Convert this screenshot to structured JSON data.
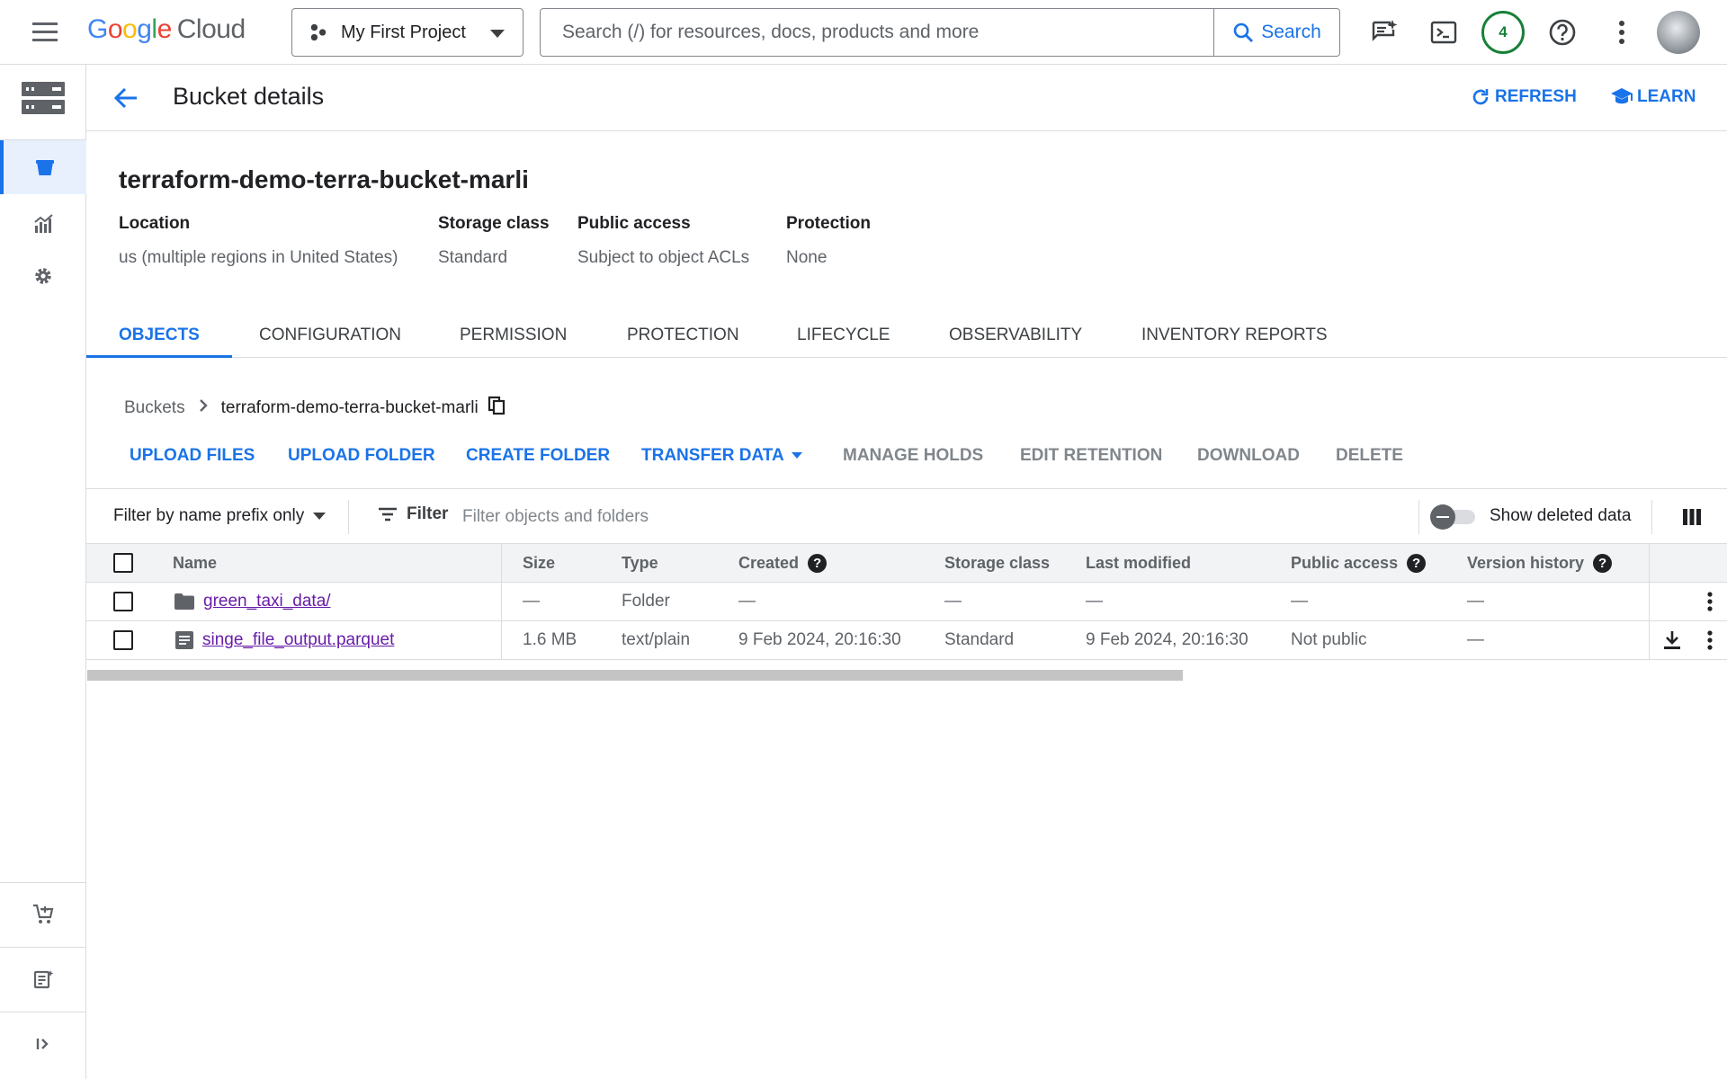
{
  "topbar": {
    "logo_google": [
      "G",
      "o",
      "o",
      "g",
      "l",
      "e"
    ],
    "logo_product": "Cloud",
    "project_name": "My First Project",
    "search_placeholder": "Search (/) for resources, docs, products and more",
    "search_button": "Search",
    "notification_count": "4"
  },
  "header": {
    "title": "Bucket details",
    "refresh_label": "REFRESH",
    "learn_label": "LEARN"
  },
  "bucket": {
    "name": "terraform-demo-terra-bucket-marli",
    "info": [
      {
        "label": "Location",
        "value": "us (multiple regions in United States)"
      },
      {
        "label": "Storage class",
        "value": "Standard"
      },
      {
        "label": "Public access",
        "value": "Subject to object ACLs"
      },
      {
        "label": "Protection",
        "value": "None"
      }
    ]
  },
  "tabs": [
    "OBJECTS",
    "CONFIGURATION",
    "PERMISSION",
    "PROTECTION",
    "LIFECYCLE",
    "OBSERVABILITY",
    "INVENTORY REPORTS"
  ],
  "breadcrumb": {
    "root": "Buckets",
    "current": "terraform-demo-terra-bucket-marli"
  },
  "actions": {
    "upload_files": "UPLOAD FILES",
    "upload_folder": "UPLOAD FOLDER",
    "create_folder": "CREATE FOLDER",
    "transfer_data": "TRANSFER DATA",
    "manage_holds": "MANAGE HOLDS",
    "edit_retention": "EDIT RETENTION",
    "download": "DOWNLOAD",
    "delete": "DELETE"
  },
  "filterbar": {
    "mode": "Filter by name prefix only",
    "filter_label": "Filter",
    "filter_placeholder": "Filter objects and folders",
    "show_deleted_label": "Show deleted data"
  },
  "table": {
    "columns": {
      "name": "Name",
      "size": "Size",
      "type": "Type",
      "created": "Created",
      "storage_class": "Storage class",
      "last_modified": "Last modified",
      "public_access": "Public access",
      "version_history": "Version history"
    },
    "help_glyph": "?",
    "rows": [
      {
        "name": "green_taxi_data/",
        "size": "—",
        "type": "Folder",
        "created": "—",
        "storage_class": "—",
        "last_modified": "—",
        "public_access": "—",
        "version_history": "—"
      },
      {
        "name": "singe_file_output.parquet",
        "size": "1.6 MB",
        "type": "text/plain",
        "created": "9 Feb 2024, 20:16:30",
        "storage_class": "Standard",
        "last_modified": "9 Feb 2024, 20:16:30",
        "public_access": "Not public",
        "version_history": "—"
      }
    ]
  },
  "colors": {
    "accent": "#1a73e8",
    "visited_link": "#681da8",
    "notification": "#188038"
  }
}
